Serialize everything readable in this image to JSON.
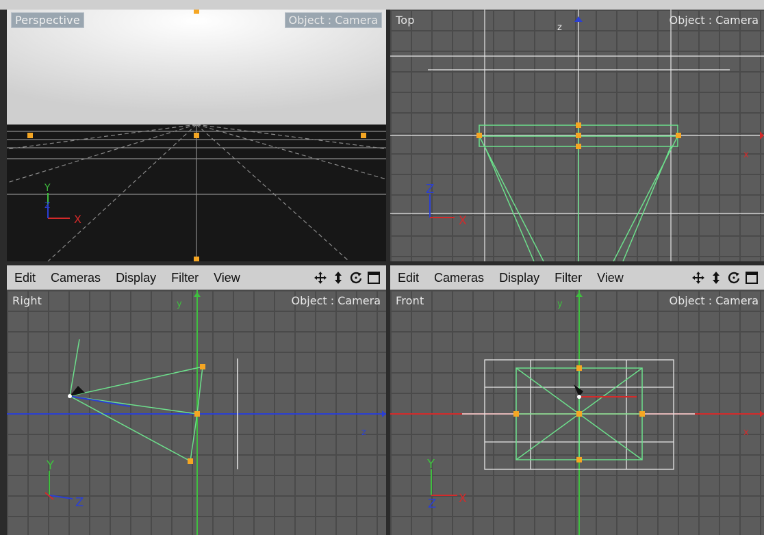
{
  "viewports": {
    "perspective": {
      "label": "Perspective",
      "object": "Object : Camera"
    },
    "top": {
      "label": "Top",
      "object": "Object : Camera"
    },
    "right": {
      "label": "Right",
      "object": "Object : Camera"
    },
    "front": {
      "label": "Front",
      "object": "Object : Camera"
    }
  },
  "menu_left": [
    "Edit",
    "Cameras",
    "Display",
    "Filter",
    "View"
  ],
  "menu_right": [
    "Edit",
    "Cameras",
    "Display",
    "Filter",
    "View"
  ],
  "tool_icons": [
    "move-icon",
    "scale-arrow-icon",
    "rotate-icon",
    "maximize-icon"
  ],
  "axis_letters": {
    "x": "X",
    "y": "Y",
    "z": "Z",
    "z_small": "z",
    "x_small": "x",
    "y_small": "y"
  },
  "colors": {
    "x_axis": "#d42a2a",
    "y_axis": "#3fbf3f",
    "z_axis": "#2a3fd4",
    "camera": "#6de08c",
    "handle": "#f5a623",
    "grid_bg": "#5c5c5c"
  }
}
